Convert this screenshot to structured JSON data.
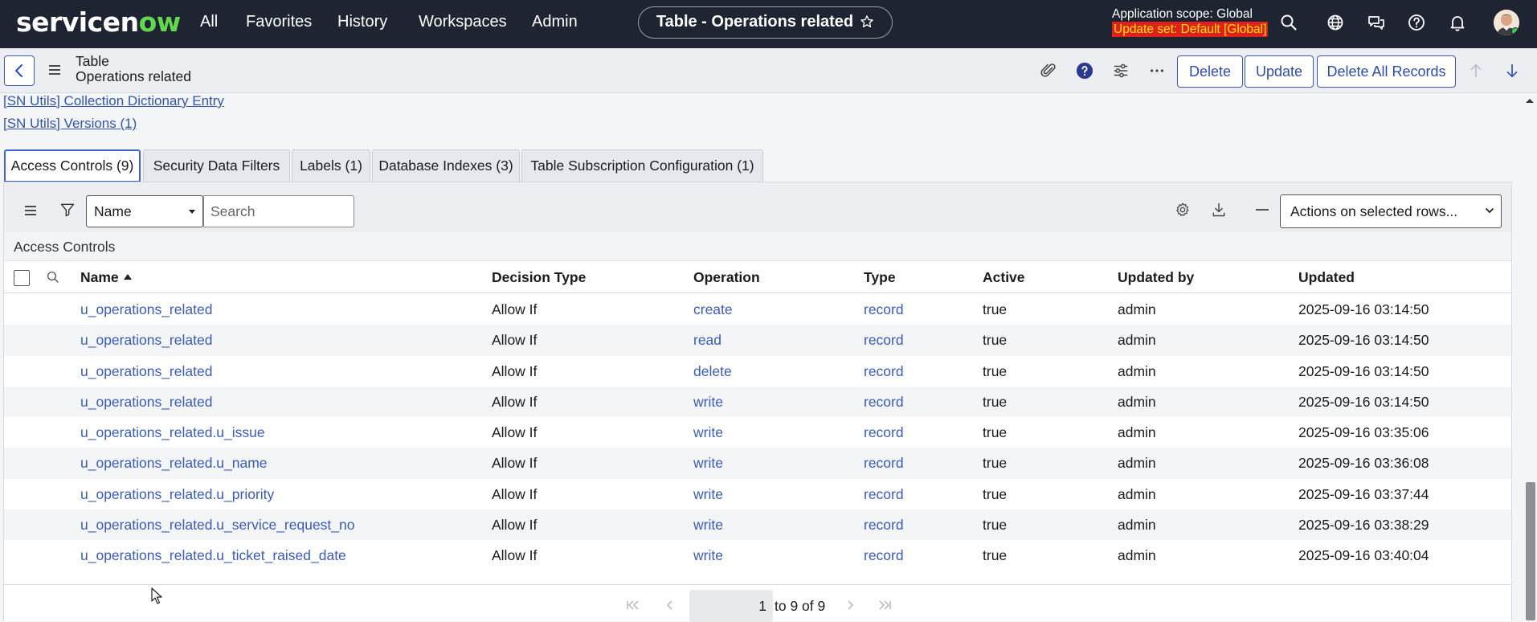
{
  "nav": {
    "logo_text_a": "servicen",
    "logo_text_b": "ow",
    "menu": [
      "All",
      "Favorites",
      "History",
      "Workspaces",
      "Admin"
    ],
    "page_title": "Table - Operations related",
    "scope_label": "Application scope: Global",
    "update_set_label": "Update set: Default [Global]"
  },
  "header": {
    "title_line1": "Table",
    "title_line2": "Operations related",
    "buttons": {
      "delete": "Delete",
      "update": "Update",
      "delete_all": "Delete All Records"
    }
  },
  "related_links": [
    "[SN Utils] Collection Dictionary Entry",
    "[SN Utils] Versions (1)"
  ],
  "tabs": [
    "Access Controls (9)",
    "Security Data Filters",
    "Labels (1)",
    "Database Indexes (3)",
    "Table Subscription Configuration (1)"
  ],
  "list": {
    "field_select": "Name",
    "search_placeholder": "Search",
    "actions_select": "Actions on selected rows...",
    "caption": "Access Controls",
    "columns": [
      "Name",
      "Decision Type",
      "Operation",
      "Type",
      "Active",
      "Updated by",
      "Updated"
    ],
    "rows": [
      [
        "u_operations_related",
        "Allow If",
        "create",
        "record",
        "true",
        "admin",
        "2025-09-16 03:14:50"
      ],
      [
        "u_operations_related",
        "Allow If",
        "read",
        "record",
        "true",
        "admin",
        "2025-09-16 03:14:50"
      ],
      [
        "u_operations_related",
        "Allow If",
        "delete",
        "record",
        "true",
        "admin",
        "2025-09-16 03:14:50"
      ],
      [
        "u_operations_related",
        "Allow If",
        "write",
        "record",
        "true",
        "admin",
        "2025-09-16 03:14:50"
      ],
      [
        "u_operations_related.u_issue",
        "Allow If",
        "write",
        "record",
        "true",
        "admin",
        "2025-09-16 03:35:06"
      ],
      [
        "u_operations_related.u_name",
        "Allow If",
        "write",
        "record",
        "true",
        "admin",
        "2025-09-16 03:36:08"
      ],
      [
        "u_operations_related.u_priority",
        "Allow If",
        "write",
        "record",
        "true",
        "admin",
        "2025-09-16 03:37:44"
      ],
      [
        "u_operations_related.u_service_request_no",
        "Allow If",
        "write",
        "record",
        "true",
        "admin",
        "2025-09-16 03:38:29"
      ],
      [
        "u_operations_related.u_ticket_raised_date",
        "Allow If",
        "write",
        "record",
        "true",
        "admin",
        "2025-09-16 03:40:04"
      ]
    ],
    "pager": {
      "page": "1",
      "range_text": "to 9 of 9"
    }
  },
  "colors": {
    "nav_bg": "#1f2433",
    "link": "#3a5bb7",
    "accent_border": "#3a5ab4",
    "update_set_bg": "#e0201a",
    "update_set_text": "#ffe600"
  },
  "icons": [
    "search-icon",
    "globe-icon",
    "chat-icon",
    "help-icon",
    "bell-icon",
    "paperclip-icon",
    "question-icon",
    "sliders-icon",
    "more-icon",
    "arrow-up-icon",
    "arrow-down-icon",
    "menu-icon",
    "filter-icon",
    "gear-icon",
    "download-icon",
    "minus-icon"
  ]
}
